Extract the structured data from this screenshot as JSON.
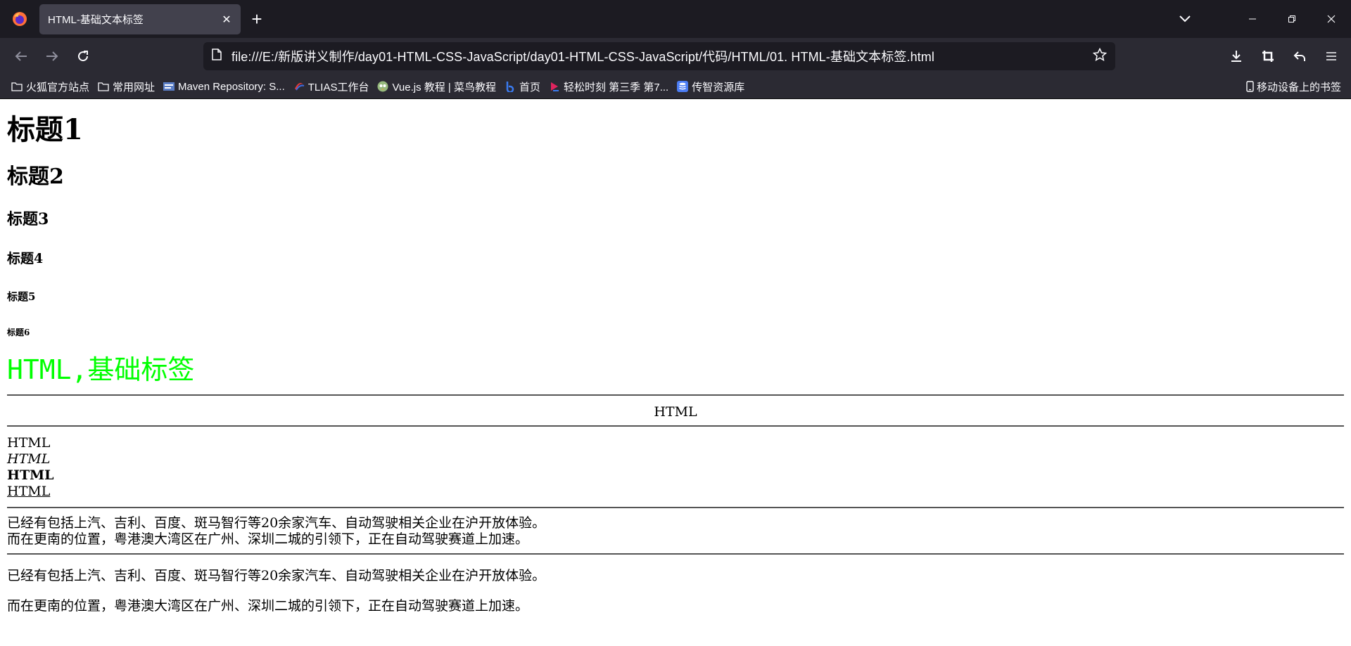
{
  "browser": {
    "tab_title": "HTML-基础文本标签",
    "url": "file:///E:/新版讲义制作/day01-HTML-CSS-JavaScript/day01-HTML-CSS-JavaScript/代码/HTML/01. HTML-基础文本标签.html",
    "bookmarks": [
      {
        "label": "火狐官方站点",
        "icon": "folder-icon"
      },
      {
        "label": "常用网址",
        "icon": "folder-icon"
      },
      {
        "label": "Maven Repository: S...",
        "icon": "maven-icon"
      },
      {
        "label": "TLIAS工作台",
        "icon": "tlias-icon"
      },
      {
        "label": "Vue.js 教程 | 菜鸟教程",
        "icon": "runoob-icon"
      },
      {
        "label": "首页",
        "icon": "baidu-icon"
      },
      {
        "label": "轻松时刻 第三季 第7...",
        "icon": "video-icon"
      },
      {
        "label": "传智资源库",
        "icon": "database-icon"
      }
    ],
    "mobile_bookmarks": "移动设备上的书签"
  },
  "page": {
    "h1": "标题1",
    "h2": "标题2",
    "h3": "标题3",
    "h4": "标题4",
    "h5": "标题5",
    "h6": "标题6",
    "green_heading": "HTML,基础标签",
    "centered": "HTML",
    "plain": "HTML",
    "italic": "HTML",
    "bold": "HTML",
    "underline": "HTML",
    "line1": "已经有包括上汽、吉利、百度、斑马智行等20余家汽车、自动驾驶相关企业在沪开放体验。",
    "line2": "而在更南的位置，粤港澳大湾区在广州、深圳二城的引领下，正在自动驾驶赛道上加速。",
    "p1": "已经有包括上汽、吉利、百度、斑马智行等20余家汽车、自动驾驶相关企业在沪开放体验。",
    "p2": "而在更南的位置，粤港澳大湾区在广州、深圳二城的引领下，正在自动驾驶赛道上加速。"
  },
  "colors": {
    "chrome_dark": "#1c1b22",
    "toolbar": "#2b2a33",
    "tab_active": "#42414d",
    "green_heading": "#00ff00"
  }
}
